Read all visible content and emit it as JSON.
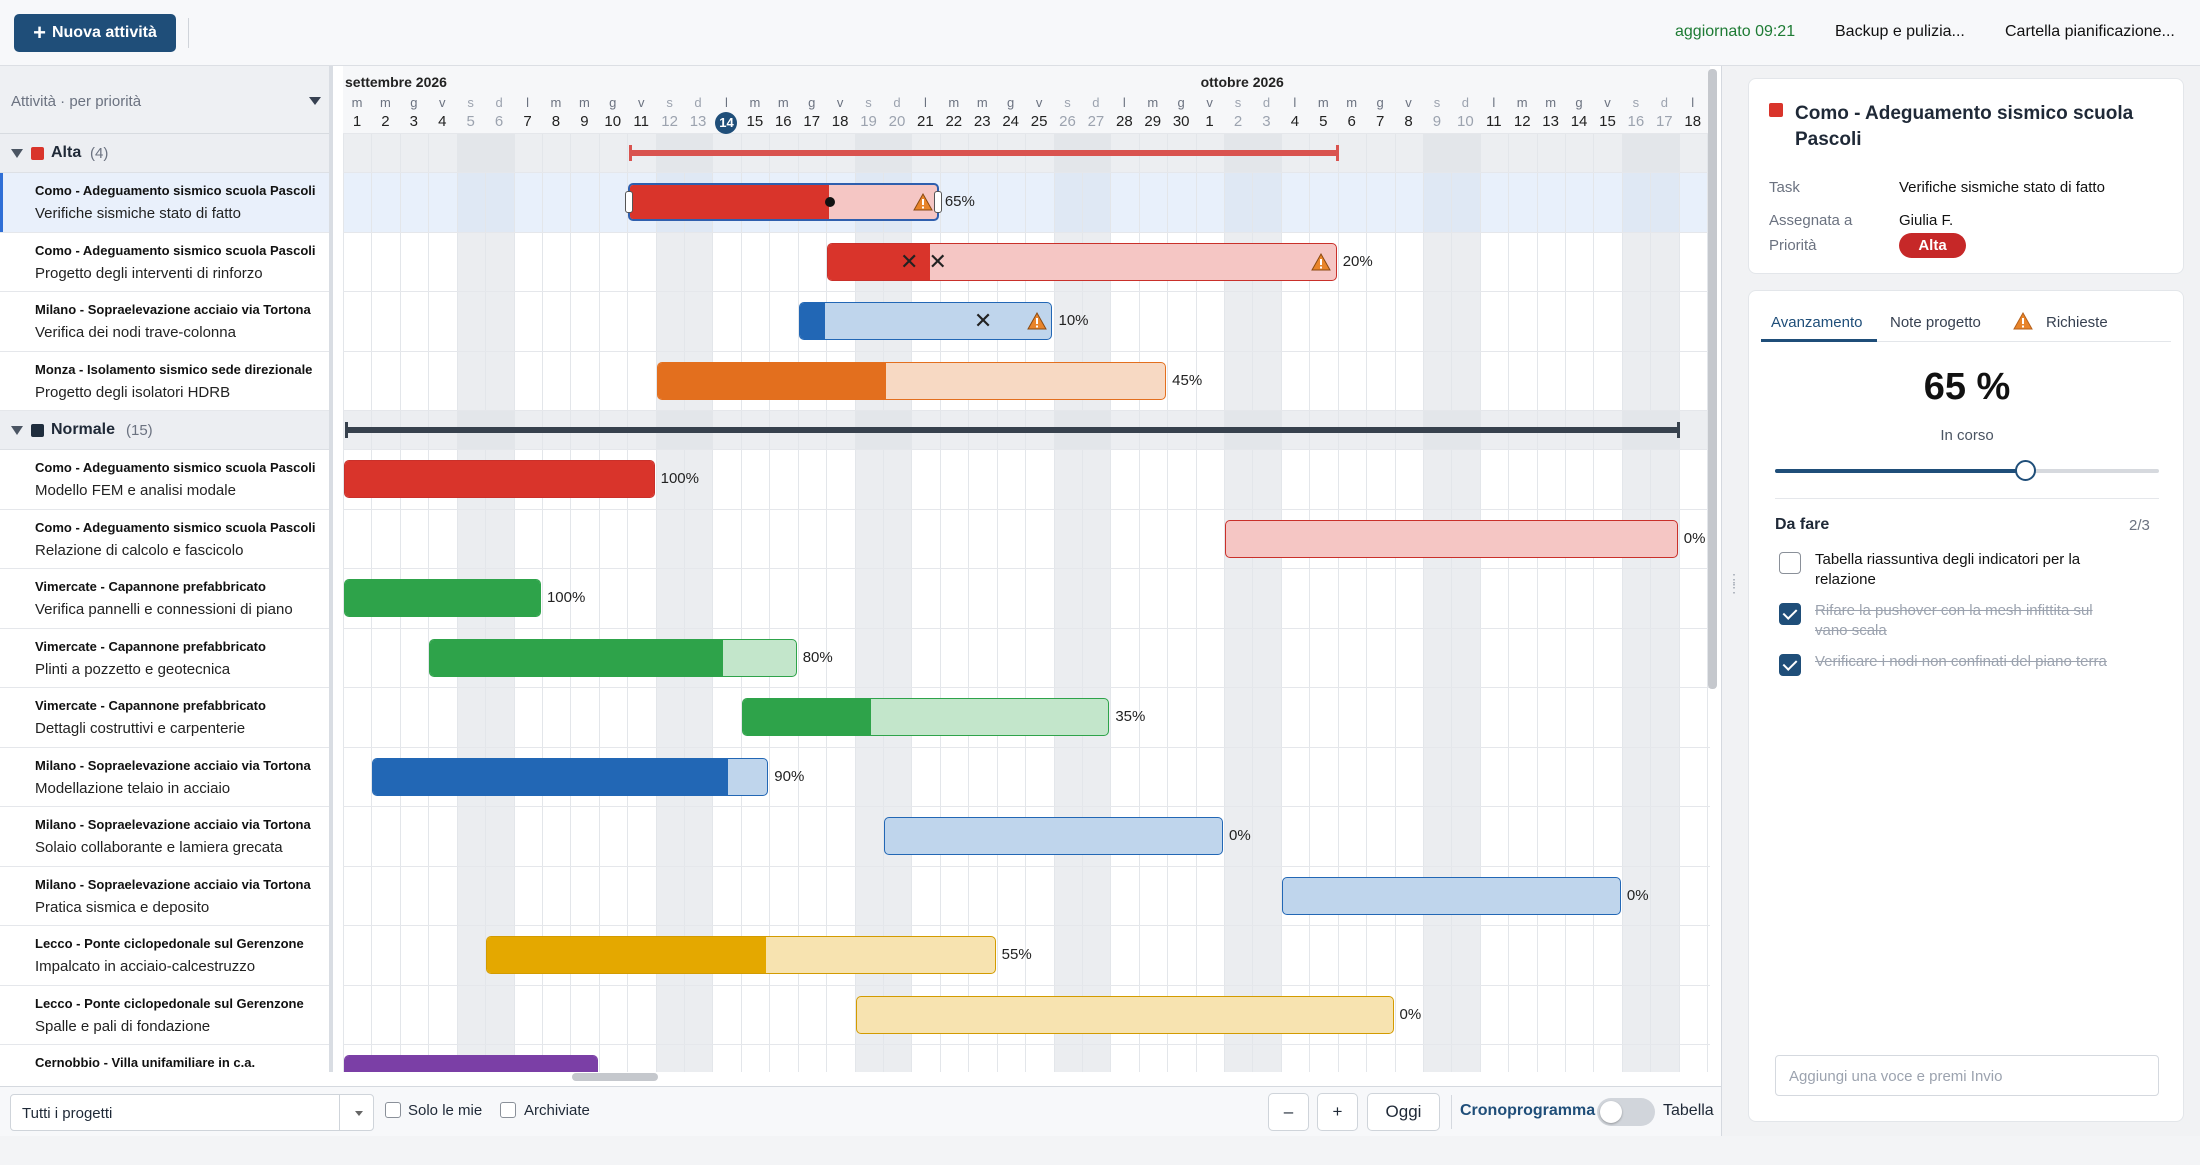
{
  "toolbar": {
    "new_task": "Nuova attività",
    "updated": "aggiornato 09:21",
    "backup": "Backup e pulizia...",
    "folder": "Cartella pianificazione..."
  },
  "tasklist": {
    "header": "Attività · per priorità",
    "groups": [
      {
        "name": "Alta",
        "count": "(4)",
        "color": "#d9342b"
      },
      {
        "name": "Normale",
        "count": "(15)",
        "color": "#1f2d3d"
      }
    ],
    "rows": [
      {
        "project": "Como - Adeguamento sismico scuola Pascoli",
        "task": "Verifiche sismiche stato di fatto"
      },
      {
        "project": "Como - Adeguamento sismico scuola Pascoli",
        "task": "Progetto degli interventi di rinforzo"
      },
      {
        "project": "Milano - Sopraelevazione acciaio via Tortona",
        "task": "Verifica dei nodi trave-colonna"
      },
      {
        "project": "Monza - Isolamento sismico sede direzionale",
        "task": "Progetto degli isolatori HDRB"
      },
      {
        "project": "Como - Adeguamento sismico scuola Pascoli",
        "task": "Modello FEM e analisi modale"
      },
      {
        "project": "Como - Adeguamento sismico scuola Pascoli",
        "task": "Relazione di calcolo e fascicolo"
      },
      {
        "project": "Vimercate - Capannone prefabbricato",
        "task": "Verifica pannelli e connessioni di piano"
      },
      {
        "project": "Vimercate - Capannone prefabbricato",
        "task": "Plinti a pozzetto e geotecnica"
      },
      {
        "project": "Vimercate - Capannone prefabbricato",
        "task": "Dettagli costruttivi e carpenterie"
      },
      {
        "project": "Milano - Sopraelevazione acciaio via Tortona",
        "task": "Modellazione telaio in acciaio"
      },
      {
        "project": "Milano - Sopraelevazione acciaio via Tortona",
        "task": "Solaio collaborante e lamiera grecata"
      },
      {
        "project": "Milano - Sopraelevazione acciaio via Tortona",
        "task": "Pratica sismica e deposito"
      },
      {
        "project": "Lecco - Ponte ciclopedonale sul Gerenzone",
        "task": "Impalcato in acciaio-calcestruzzo"
      },
      {
        "project": "Lecco - Ponte ciclopedonale sul Gerenzone",
        "task": "Spalle e pali di fondazione"
      },
      {
        "project": "Cernobbio - Villa unifamiliare in c.a.",
        "task": ""
      }
    ]
  },
  "timeline": {
    "months": [
      "settembre 2026",
      "ottobre 2026"
    ],
    "day_letters": [
      "m",
      "m",
      "g",
      "v",
      "s",
      "d",
      "l",
      "m",
      "m",
      "g",
      "v",
      "s",
      "d",
      "l",
      "m",
      "m",
      "g",
      "v",
      "s",
      "d",
      "l",
      "m",
      "m",
      "g",
      "v",
      "s",
      "d",
      "l",
      "m",
      "g",
      "v",
      "s",
      "d",
      "l",
      "m",
      "m",
      "g",
      "v",
      "s",
      "d",
      "l",
      "m",
      "m",
      "g",
      "v",
      "s",
      "d",
      "l"
    ],
    "day_numbers": [
      "1",
      "2",
      "3",
      "4",
      "5",
      "6",
      "7",
      "8",
      "9",
      "10",
      "11",
      "12",
      "13",
      "14",
      "15",
      "16",
      "17",
      "18",
      "19",
      "20",
      "21",
      "22",
      "23",
      "24",
      "25",
      "26",
      "27",
      "28",
      "29",
      "30",
      "1",
      "2",
      "3",
      "4",
      "5",
      "6",
      "7",
      "8",
      "9",
      "10",
      "11",
      "12",
      "13",
      "14",
      "15",
      "16",
      "17",
      "18"
    ],
    "today_index": 13,
    "bars": [
      {
        "row": 0,
        "start": 10,
        "end": 21,
        "progress": 65,
        "label": "65%",
        "color": "#d9342b",
        "light": "#f5c6c4",
        "border": "#2f5fae",
        "warn": true,
        "handles": true,
        "dot": true
      },
      {
        "row": 1,
        "start": 17,
        "end": 35,
        "progress": 20,
        "label": "20%",
        "color": "#d9342b",
        "light": "#f5c6c4",
        "border": "#c9302a",
        "warn": true,
        "x": [
          19.6,
          20.6
        ]
      },
      {
        "row": 2,
        "start": 16,
        "end": 25,
        "progress": 10,
        "label": "10%",
        "color": "#2267b5",
        "light": "#bfd5ec",
        "border": "#2267b5",
        "warn": true,
        "x": [
          22.2
        ]
      },
      {
        "row": 3,
        "start": 11,
        "end": 29,
        "progress": 45,
        "label": "45%",
        "color": "#e36f1e",
        "light": "#f7d9c3",
        "border": "#e36f1e"
      },
      {
        "row": 4,
        "start": 0,
        "end": 11,
        "progress": 100,
        "label": "100%",
        "color": "#d9342b",
        "light": "#f5c6c4",
        "border": "#c9302a"
      },
      {
        "row": 5,
        "start": 31,
        "end": 47,
        "progress": 0,
        "label": "0%",
        "color": "#d9342b",
        "light": "#f5c6c4",
        "border": "#c9302a"
      },
      {
        "row": 6,
        "start": 0,
        "end": 7,
        "progress": 100,
        "label": "100%",
        "color": "#2ea34a",
        "light": "#c3e6cb",
        "border": "#2ea34a"
      },
      {
        "row": 7,
        "start": 3,
        "end": 16,
        "progress": 80,
        "label": "80%",
        "color": "#2ea34a",
        "light": "#c3e6cb",
        "border": "#2ea34a"
      },
      {
        "row": 8,
        "start": 14,
        "end": 27,
        "progress": 35,
        "label": "35%",
        "color": "#2ea34a",
        "light": "#c3e6cb",
        "border": "#2ea34a"
      },
      {
        "row": 9,
        "start": 1,
        "end": 15,
        "progress": 90,
        "label": "90%",
        "color": "#2267b5",
        "light": "#bfd5ec",
        "border": "#2267b5"
      },
      {
        "row": 10,
        "start": 19,
        "end": 31,
        "progress": 0,
        "label": "0%",
        "color": "#2267b5",
        "light": "#bfd5ec",
        "border": "#2267b5"
      },
      {
        "row": 11,
        "start": 33,
        "end": 45,
        "progress": 0,
        "label": "0%",
        "color": "#2267b5",
        "light": "#bfd5ec",
        "border": "#2267b5"
      },
      {
        "row": 12,
        "start": 5,
        "end": 23,
        "progress": 55,
        "label": "55%",
        "color": "#e4a800",
        "light": "#f7e3b0",
        "border": "#d39b00"
      },
      {
        "row": 13,
        "start": 18,
        "end": 37,
        "progress": 0,
        "label": "0%",
        "color": "#e4a800",
        "light": "#f7e3b0",
        "border": "#d39b00"
      },
      {
        "row": 14,
        "start": 0,
        "end": 9,
        "progress": 100,
        "label": "",
        "color": "#7b3fa6",
        "light": "#dcc6ec",
        "border": "#7b3fa6"
      }
    ],
    "summaries": [
      {
        "group": 0,
        "start": 10,
        "end": 35,
        "color": "#d9534f"
      },
      {
        "group": 1,
        "start": 0,
        "end": 47,
        "color": "#37414d"
      }
    ]
  },
  "bottom": {
    "project_filter": "Tutti i progetti",
    "only_mine": "Solo le mie",
    "archived": "Archiviate",
    "zoom_out": "–",
    "zoom_in": "+",
    "today": "Oggi",
    "view_gantt": "Cronoprogramma",
    "view_table": "Tabella"
  },
  "detail": {
    "title": "Como - Adeguamento sismico scuola Pascoli",
    "priority_color": "#d9342b",
    "task_label": "Task",
    "task_value": "Verifiche sismiche stato di fatto",
    "assigned_label": "Assegnata a",
    "assigned_value": "Giulia F.",
    "priority_label": "Priorità",
    "priority_value": "Alta",
    "tabs": [
      "Avanzamento",
      "Note progetto",
      "Richieste"
    ],
    "progress_text": "65 %",
    "progress_value": 65,
    "status": "In corso",
    "todo_header": "Da fare",
    "todo_count": "2/3",
    "todos": [
      {
        "text": "Tabella riassuntiva degli indicatori per la relazione",
        "done": false
      },
      {
        "text": "Rifare la pushover con la mesh infittita sul vano scala",
        "done": true
      },
      {
        "text": "Verificare i nodi non confinati del piano terra",
        "done": true
      }
    ],
    "add_placeholder": "Aggiungi una voce e premi Invio"
  }
}
